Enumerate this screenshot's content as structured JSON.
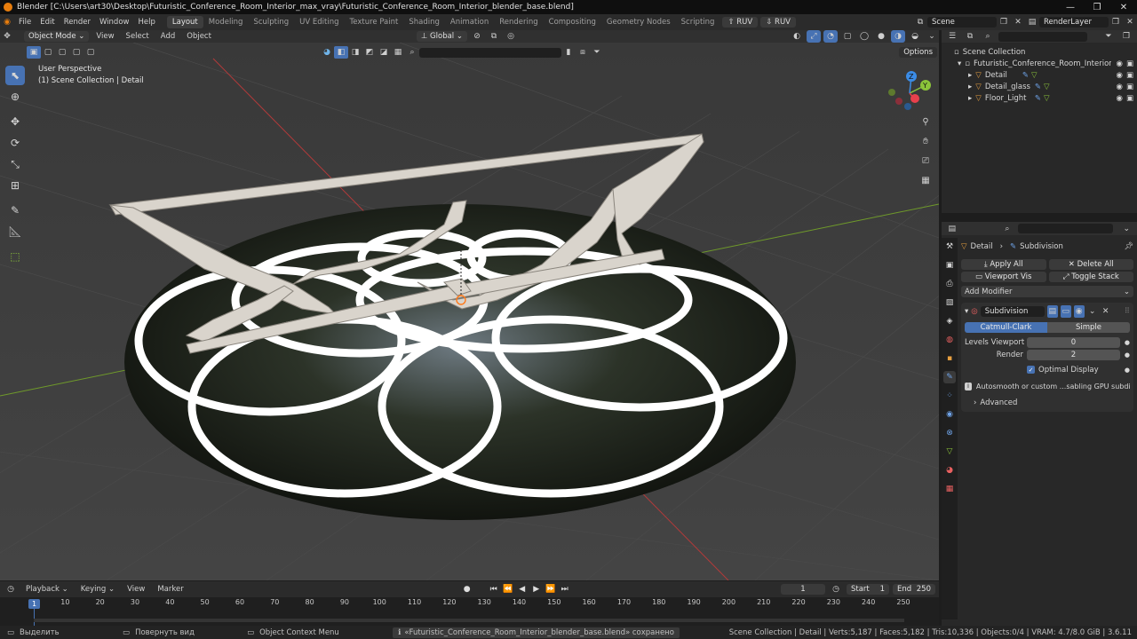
{
  "titlebar": {
    "title": "Blender [C:\\Users\\art30\\Desktop\\Futuristic_Conference_Room_Interior_max_vray\\Futuristic_Conference_Room_Interior_blender_base.blend]",
    "minimize": "—",
    "maximize": "❐",
    "close": "✕"
  },
  "menubar": {
    "menus": [
      "File",
      "Edit",
      "Render",
      "Window",
      "Help"
    ],
    "workspaces": [
      "Layout",
      "Modeling",
      "Sculpting",
      "UV Editing",
      "Texture Paint",
      "Shading",
      "Animation",
      "Rendering",
      "Compositing",
      "Geometry Nodes",
      "Scripting"
    ],
    "active_workspace": "Layout",
    "ruv1": "RUV",
    "ruv2": "RUV",
    "scene": "Scene",
    "renderlayer": "RenderLayer"
  },
  "viewport_header": {
    "mode": "Object Mode",
    "menus": [
      "View",
      "Select",
      "Add",
      "Object"
    ],
    "orientation": "Global",
    "options": "Options"
  },
  "viewport": {
    "perspective": "User Perspective",
    "collection": "(1) Scene Collection | Detail",
    "colors": {
      "bg": "#3c3c3c",
      "frame": "#d9d4cc",
      "rings": "#ffffff",
      "xaxis": "#b43a3a",
      "yaxis": "#6f9a2a",
      "gizmo_x": "#e8404c",
      "gizmo_y": "#8bc43a",
      "gizmo_z": "#3b8ce6"
    },
    "gizmo_labels": {
      "y": "Y",
      "z": "Z"
    }
  },
  "outliner": {
    "root": "Scene Collection",
    "collection": "Futuristic_Conference_Room_Interior",
    "objects": [
      "Detail",
      "Detail_glass",
      "Floor_Light"
    ]
  },
  "properties": {
    "breadcrumb_object": "Detail",
    "breadcrumb_modifier": "Subdivision",
    "apply_all": "Apply All",
    "delete_all": "Delete All",
    "viewport_vis": "Viewport Vis",
    "toggle_stack": "Toggle Stack",
    "add_modifier": "Add Modifier",
    "modifier_name": "Subdivision",
    "catmull": "Catmull-Clark",
    "simple": "Simple",
    "levels_viewport_label": "Levels Viewport",
    "levels_viewport": "0",
    "render_label": "Render",
    "render": "2",
    "optimal_display": "Optimal Display",
    "info": "Autosmooth or custom ...sabling GPU subdivision",
    "advanced": "Advanced"
  },
  "timeline": {
    "menus": [
      "Playback",
      "Keying",
      "View",
      "Marker"
    ],
    "current_frame": "1",
    "start_label": "Start",
    "start": "1",
    "end_label": "End",
    "end": "250",
    "ticks": [
      "1",
      "10",
      "20",
      "30",
      "40",
      "50",
      "60",
      "70",
      "80",
      "90",
      "100",
      "110",
      "120",
      "130",
      "140",
      "150",
      "160",
      "170",
      "180",
      "190",
      "200",
      "210",
      "220",
      "230",
      "240",
      "250"
    ]
  },
  "statusbar": {
    "select": "Выделить",
    "rotate": "Повернуть вид",
    "context": "Object Context Menu",
    "saved": "«Futuristic_Conference_Room_Interior_blender_base.blend» сохранено",
    "stats": "Scene Collection | Detail | Verts:5,187 | Faces:5,182 | Tris:10,336 | Objects:0/4 | VRAM: 4.7/8.0 GiB | 3.6.11"
  }
}
